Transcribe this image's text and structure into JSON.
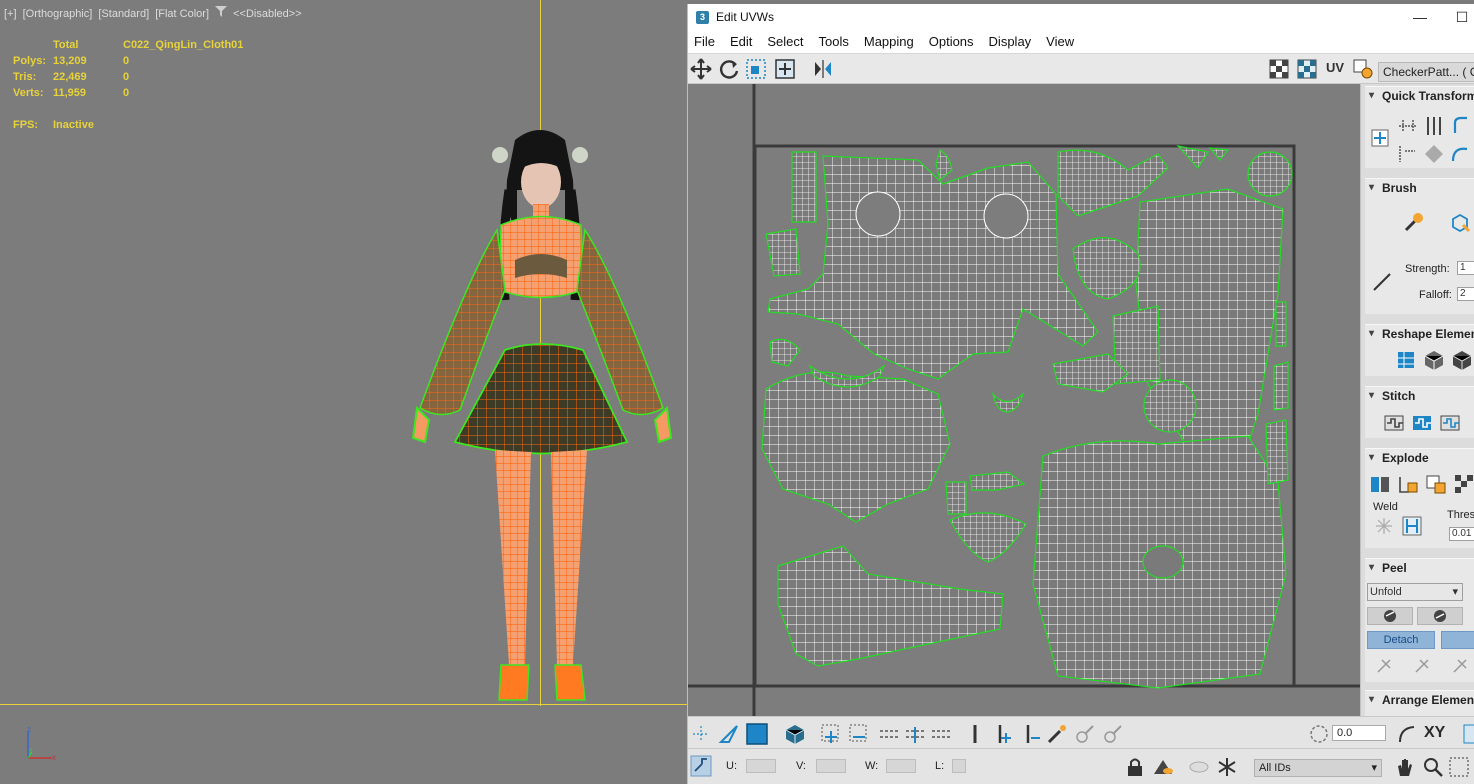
{
  "viewport": {
    "label_parts": [
      "[+]",
      "[Orthographic]",
      "[Standard]",
      "[Flat Color]",
      "<<Disabled>>"
    ],
    "stats": {
      "header": {
        "total": "Total",
        "object": "C022_QingLin_Cloth01"
      },
      "rows": [
        {
          "label": "Polys:",
          "total": "13,209",
          "object": "0"
        },
        {
          "label": "Tris:",
          "total": "22,469",
          "object": "0"
        },
        {
          "label": "Verts:",
          "total": "11,959",
          "object": "0"
        }
      ],
      "fps_label": "FPS:",
      "fps_value": "Inactive"
    },
    "axis": {
      "z": "z",
      "x": "x",
      "y": "y"
    }
  },
  "uv_window": {
    "title": "Edit UVWs",
    "app_icon": "3",
    "menu": [
      "File",
      "Edit",
      "Select",
      "Tools",
      "Mapping",
      "Options",
      "Display",
      "View"
    ],
    "toolbar_right": {
      "uv_label": "UV",
      "checker_dropdown": "CheckerPatt... ( Che"
    },
    "panel": {
      "quick_transform": "Quick Transform",
      "brush": "Brush",
      "strength_label": "Strength:",
      "strength_value": "1",
      "falloff_label": "Falloff:",
      "falloff_value": "2",
      "reshape": "Reshape Elements",
      "stitch": "Stitch",
      "explode": "Explode",
      "weld": "Weld",
      "threshold_label": "Thres",
      "threshold_value": "0.01",
      "peel": "Peel",
      "unfold_dropdown": "Unfold",
      "detach_button": "Detach",
      "arrange": "Arrange Elements"
    },
    "bottom": {
      "rotation_value": "0.0",
      "u_label": "U:",
      "v_label": "V:",
      "w_label": "W:",
      "l_label": "L:",
      "ids_dropdown": "All IDs",
      "xy_label": "XY"
    }
  },
  "colors": {
    "viewport_bg": "#7c7c7c",
    "stats_text": "#e8d23a",
    "wire_orange": "#ff6a10",
    "wire_green": "#39e61e",
    "uv_canvas": "#7d7d7d",
    "uv_wire": "#ffffff",
    "uv_border": "#22dd22",
    "accent_blue": "#1e86c6"
  }
}
